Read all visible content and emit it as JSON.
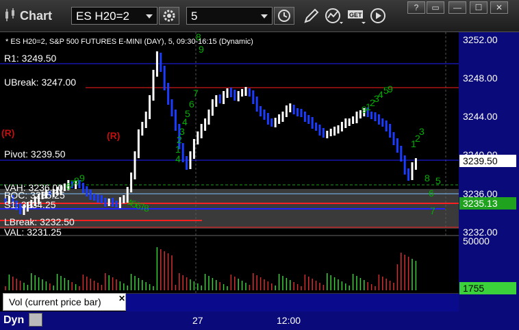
{
  "titlebar": {
    "app_title": "Chart",
    "symbol_value": "ES H20=2",
    "period_value": "5",
    "window_buttons": [
      "?",
      "▭",
      "—",
      "☐",
      "✕"
    ]
  },
  "chart": {
    "description": "* ES H20=2, S&P 500 FUTURES E-MINI (DAY), 5, 09:30-16:15 (Dynamic)",
    "price_ticks": [
      "3252.00",
      "3248.00",
      "3244.00",
      "3240.00",
      "3236.00",
      "3232.00"
    ],
    "last_price": "3239.50",
    "level_badge": "3235.13",
    "levels": {
      "r1": "R1: 3249.50",
      "ubreak": "UBreak: 3247.00",
      "pivot": "Pivot: 3239.50",
      "vah": "VAH: 3236.00",
      "poc": "POC: 3235.25",
      "s1": "S1: 3234.25",
      "lbreak": "LBreak: 3232.50",
      "val": "VAL: 3231.25"
    },
    "r_markers": [
      "(R)",
      "(R)"
    ],
    "td_counts": [
      "8",
      "9",
      "7",
      "6",
      "5",
      "4",
      "3",
      "2",
      "1",
      "9",
      "8",
      "7",
      "6",
      "5",
      "4",
      "3",
      "2",
      "1",
      "9",
      "8",
      "7",
      "6",
      "5",
      "4",
      "3",
      "2",
      "1",
      "4",
      "8",
      "5",
      "6",
      "7",
      "9"
    ]
  },
  "volume": {
    "tick_top": "50000",
    "current": "1755",
    "legend": "Vol (current price bar)",
    "close": "✕"
  },
  "time_axis": {
    "dyn": "Dyn",
    "labels": [
      "27",
      "12:00"
    ]
  },
  "colors": {
    "up_bar": "#ffffff",
    "down_bar": "#1a3cff",
    "resistance": "#ff2020",
    "pivot": "#2020ff",
    "td_count": "#00b000",
    "axis_panel": "#0a0a7a",
    "badge_green": "#1fa31f"
  }
}
